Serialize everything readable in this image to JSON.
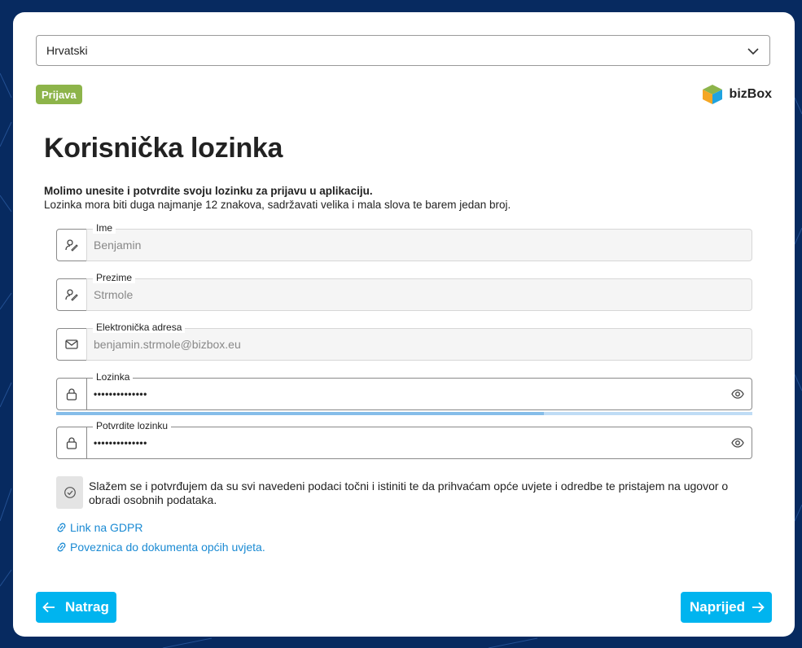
{
  "language_select": {
    "value": "Hrvatski",
    "icon": "chevron-down-icon"
  },
  "badge": "Prijava",
  "brand": {
    "name": "bizBox",
    "colors": [
      "#8db44a",
      "#f5a623",
      "#1fa3e0"
    ]
  },
  "page_title": "Korisnička lozinka",
  "intro": {
    "strong": "Molimo unesite i potvrdite svoju lozinku za prijavu u aplikaciju.",
    "normal": "Lozinka mora biti duga najmanje 12 znakova, sadržavati velika i mala slova te barem jedan broj."
  },
  "fields": {
    "first_name": {
      "label": "Ime",
      "value": "Benjamin",
      "icon": "user-edit-icon"
    },
    "last_name": {
      "label": "Prezime",
      "value": "Strmole",
      "icon": "user-edit-icon"
    },
    "email": {
      "label": "Elektronička adresa",
      "value": "benjamin.strmole@bizbox.eu",
      "icon": "mail-icon"
    },
    "password": {
      "label": "Lozinka",
      "value": "••••••••••••••",
      "icon": "lock-icon",
      "toggle_icon": "eye-icon"
    },
    "confirm_password": {
      "label": "Potvrdite lozinku",
      "value": "••••••••••••••",
      "icon": "lock-icon",
      "toggle_icon": "eye-icon"
    }
  },
  "password_strength": 0.7,
  "agreement": {
    "checked": false,
    "text": "Slažem se i potvrđujem da su svi navedeni podaci točni i istiniti te da prihvaćam opće uvjete i odredbe te pristajem na ugovor o obradi osobnih podataka."
  },
  "links": {
    "gdpr": "Link na GDPR",
    "terms": "Poveznica do dokumenta općih uvjeta."
  },
  "buttons": {
    "back": "Natrag",
    "next": "Naprijed"
  },
  "colors": {
    "accent": "#00b4ef",
    "badge": "#8db44a",
    "link": "#1a8ad3",
    "background": "#072a60"
  }
}
